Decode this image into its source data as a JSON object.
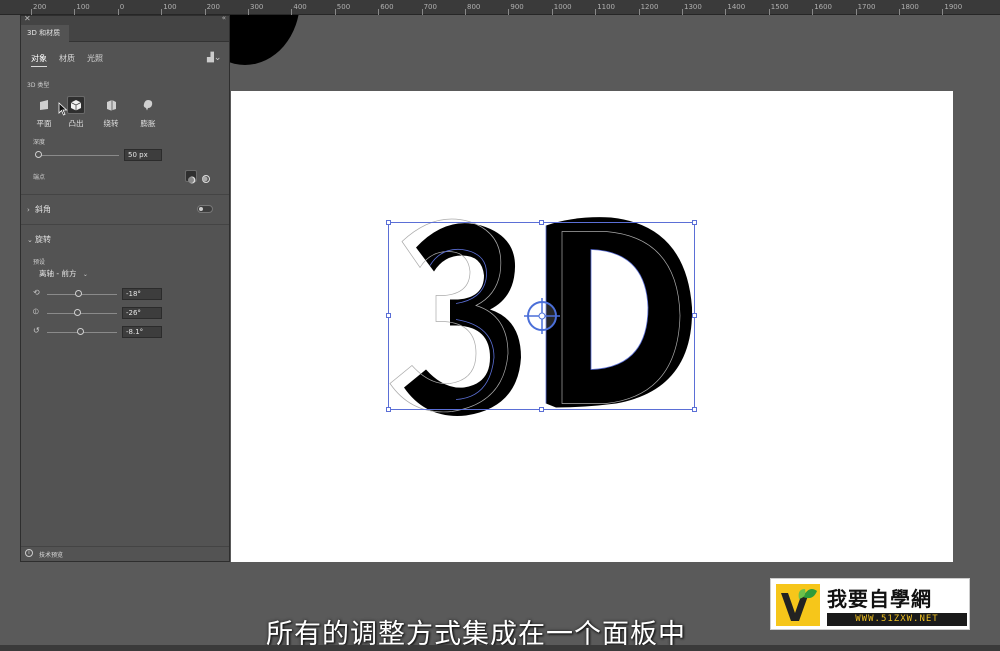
{
  "ruler": {
    "labels": [
      "200",
      "100",
      "0",
      "100",
      "200",
      "300",
      "400",
      "500",
      "600",
      "700",
      "800",
      "900",
      "1000",
      "1100",
      "1200",
      "1300",
      "1400",
      "1500",
      "1600",
      "1700",
      "1800",
      "1900"
    ]
  },
  "panel": {
    "title": "3D 和材质",
    "subtabs": [
      "对象",
      "材质",
      "光照"
    ],
    "type_section_label": "3D 类型",
    "types": [
      {
        "label": "平面",
        "icon": "plane-icon"
      },
      {
        "label": "凸出",
        "icon": "extrude-icon"
      },
      {
        "label": "绕转",
        "icon": "revolve-icon"
      },
      {
        "label": "膨胀",
        "icon": "inflate-icon"
      }
    ],
    "depth_label": "深度",
    "depth_value": "50 px",
    "cap_label": "端点",
    "bevel_label": "斜角",
    "rotation_label": "旋转",
    "preset_label": "预设",
    "preset_value": "离轴 - 前方",
    "rot_x": "-18°",
    "rot_y": "-26°",
    "rot_z": "-8.1°",
    "footer_text": "技术预览"
  },
  "canvas": {
    "artwork_text": "3D"
  },
  "subtitle": "所有的调整方式集成在一个面板中",
  "logo": {
    "name": "我要自學網",
    "url": "WWW.51ZXW.NET"
  }
}
